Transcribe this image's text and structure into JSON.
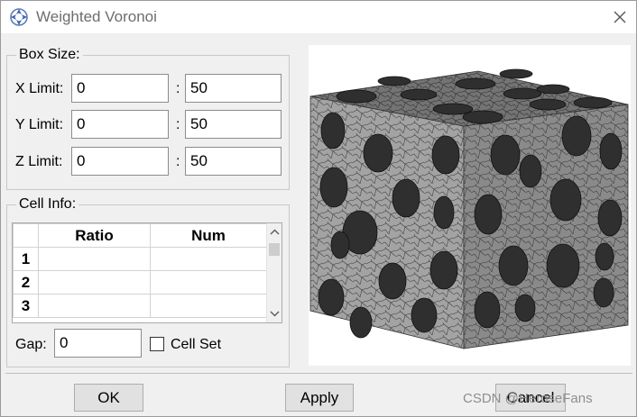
{
  "window": {
    "title": "Weighted Voronoi"
  },
  "box_size": {
    "legend": "Box Size:",
    "rows": [
      {
        "label": "X Limit:",
        "min": "0",
        "max": "50"
      },
      {
        "label": "Y Limit:",
        "min": "0",
        "max": "50"
      },
      {
        "label": "Z Limit:",
        "min": "0",
        "max": "50"
      }
    ],
    "range_separator": ":"
  },
  "cell_info": {
    "legend": "Cell Info:",
    "columns": [
      "Ratio",
      "Num"
    ],
    "rows": [
      {
        "index": "1",
        "ratio": "",
        "num": ""
      },
      {
        "index": "2",
        "ratio": "",
        "num": ""
      },
      {
        "index": "3",
        "ratio": "",
        "num": ""
      }
    ]
  },
  "gap": {
    "label": "Gap:",
    "value": "0"
  },
  "cell_set": {
    "label": "Cell Set",
    "checked": false
  },
  "buttons": {
    "ok": "OK",
    "apply": "Apply",
    "cancel": "Cancel"
  },
  "watermark": "CSDN @HeroseFans",
  "icons": {
    "app": "abaqus-logo-icon",
    "close": "close-icon",
    "scroll_up": "chevron-up-icon",
    "scroll_down": "chevron-down-icon"
  },
  "colors": {
    "mesh_light": "#a3a3a3",
    "mesh_mid": "#8a8a8a",
    "mesh_dark": "#747474",
    "inclusion": "#2f2f2f",
    "mesh_line": "#3c3c3c"
  }
}
